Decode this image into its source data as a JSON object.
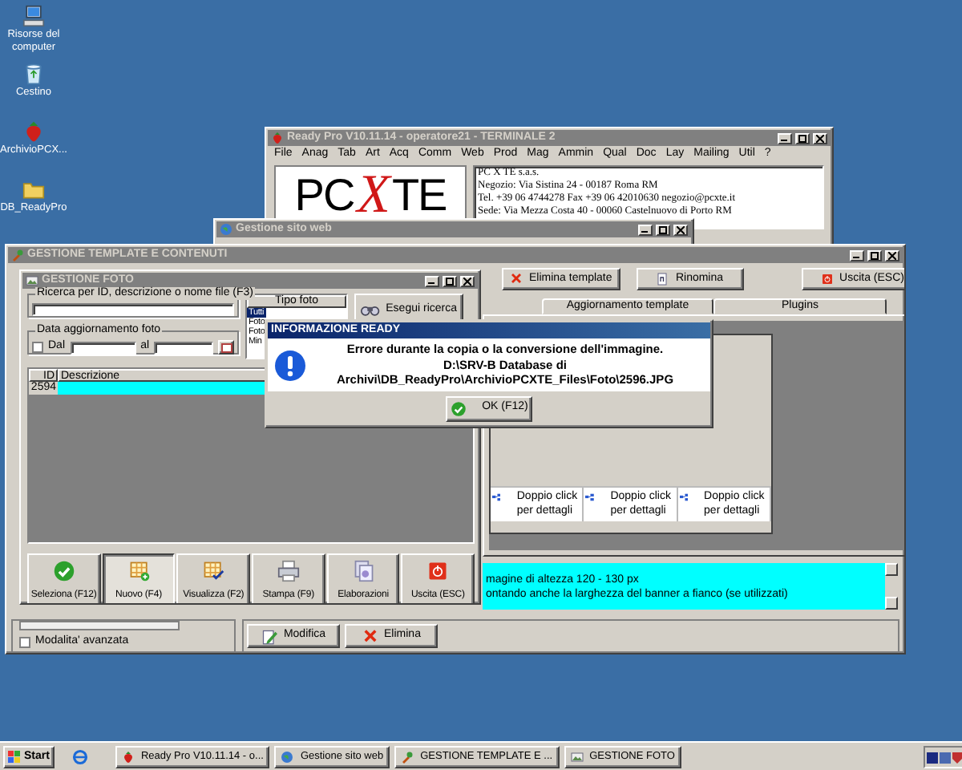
{
  "desktop_icons": [
    {
      "label": "Risorse del computer",
      "kind": "computer"
    },
    {
      "label": "Cestino",
      "kind": "recycle"
    },
    {
      "label": "ArchivioPCX...",
      "kind": "strawberry"
    },
    {
      "label": "DB_ReadyPro",
      "kind": "folder"
    }
  ],
  "ready_pro_window": {
    "title": "Ready Pro V10.11.14 - operatore21 - TERMINALE 2",
    "active": false,
    "menu": [
      "File",
      "Anag",
      "Tab",
      "Art",
      "Acq",
      "Comm",
      "Web",
      "Prod",
      "Mag",
      "Ammin",
      "Qual",
      "Doc",
      "Lay",
      "Mailing",
      "Util",
      "?"
    ],
    "logo": [
      "PC",
      "X",
      "TE"
    ],
    "company_info": [
      "PC X TE s.a.s.",
      "Negozio: Via Sistina 24 - 00187 Roma RM",
      "Tel. +39 06 4744278  Fax +39 06 42010630  negozio@pcxte.it",
      "Sede: Via Mezza Costa 40 - 00060 Castelnuovo di Porto RM"
    ]
  },
  "site_window": {
    "title": "Gestione sito web",
    "active": false
  },
  "template_window": {
    "title": "GESTIONE TEMPLATE E CONTENUTI",
    "active": false,
    "buttons": [
      {
        "label": "Elimina template",
        "kind": "delete"
      },
      {
        "label": "Rinomina",
        "kind": "rename"
      },
      {
        "label": "Uscita (ESC)",
        "kind": "exit"
      }
    ],
    "tabs": [
      {
        "label": "Aggiornamento template",
        "selected": false
      },
      {
        "label": "Plugins",
        "selected": false
      }
    ],
    "grid_cells": [
      "Doppio click per dettagli",
      "Doppio click per dettagli",
      "Doppio click per dettagli"
    ],
    "notes": [
      "magine di altezza 120 - 130 px",
      "ontando anche la larghezza del banner a fianco (se utilizzati)"
    ],
    "advanced_mode": {
      "label": "Modalita' avanzata",
      "checked": false
    },
    "actions": [
      {
        "label": "Modifica",
        "kind": "edit"
      },
      {
        "label": "Elimina",
        "kind": "delete"
      }
    ]
  },
  "photo_window": {
    "title": "GESTIONE FOTO",
    "active": false,
    "search": {
      "label": "Ricerca per ID, descrizione o nome file (F3)"
    },
    "date_filter": {
      "label": "Data aggiornamento foto",
      "from_label": "Dal",
      "from_checked": false,
      "to_label": "al"
    },
    "photo_type": {
      "header": "Tipo foto",
      "items": [
        {
          "label": "Tutti",
          "selected": true
        },
        {
          "label": "Foto",
          "selected": false
        },
        {
          "label": "Foto",
          "selected": false
        },
        {
          "label": "Min",
          "selected": false
        }
      ]
    },
    "search_button": "Esegui ricerca",
    "table": {
      "columns": [
        "ID",
        "Descrizione"
      ],
      "rows": [
        {
          "id": "2594",
          "selected": true
        }
      ]
    },
    "toolbar": [
      {
        "label": "Seleziona (F12)",
        "kind": "select",
        "pressed": false
      },
      {
        "label": "Nuovo (F4)",
        "kind": "new",
        "pressed": true
      },
      {
        "label": "Visualizza (F2)",
        "kind": "view",
        "pressed": false
      },
      {
        "label": "Stampa (F9)",
        "kind": "print",
        "pressed": false
      },
      {
        "label": "Elaborazioni",
        "kind": "process",
        "pressed": false
      },
      {
        "label": "Uscita (ESC)",
        "kind": "exit",
        "pressed": false
      }
    ]
  },
  "dialog": {
    "title": "INFORMAZIONE READY",
    "active": true,
    "message": [
      "Errore durante la copia o la conversione dell'immagine.",
      "D:\\SRV-B Database di",
      "Archivi\\DB_ReadyPro\\ArchivioPCXTE_Files\\Foto\\2596.JPG"
    ],
    "button": "OK (F12)"
  },
  "taskbar": {
    "start": "Start",
    "items": [
      {
        "label": "Ready Pro V10.11.14 - o...",
        "kind": "strawberry",
        "selected": false
      },
      {
        "label": "Gestione sito web",
        "kind": "globe",
        "selected": false
      },
      {
        "label": "GESTIONE TEMPLATE E ...",
        "kind": "tool",
        "selected": false
      },
      {
        "label": "GESTIONE FOTO",
        "kind": "photo",
        "selected": false
      }
    ]
  }
}
